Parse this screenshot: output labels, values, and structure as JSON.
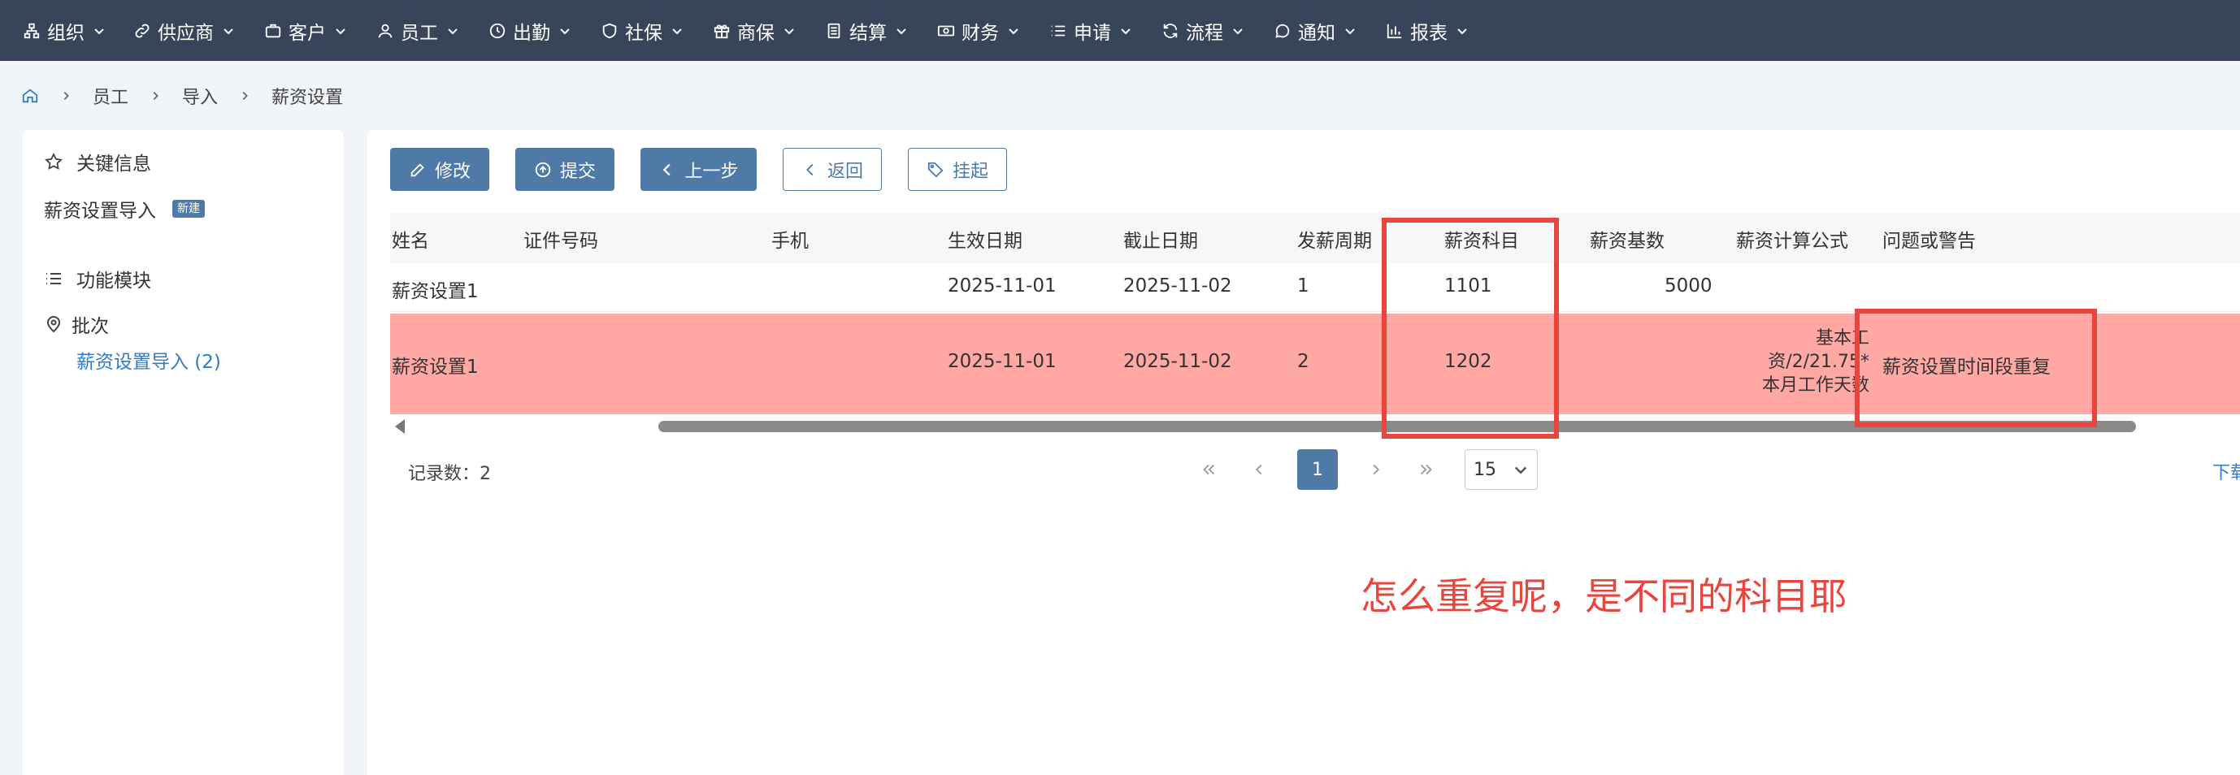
{
  "nav": {
    "items": [
      {
        "label": "组织",
        "icon": "org-icon"
      },
      {
        "label": "供应商",
        "icon": "link-icon"
      },
      {
        "label": "客户",
        "icon": "briefcase-icon"
      },
      {
        "label": "员工",
        "icon": "user-icon"
      },
      {
        "label": "出勤",
        "icon": "clock-icon"
      },
      {
        "label": "社保",
        "icon": "shield-icon"
      },
      {
        "label": "商保",
        "icon": "gift-icon"
      },
      {
        "label": "结算",
        "icon": "document-icon"
      },
      {
        "label": "财务",
        "icon": "money-icon"
      },
      {
        "label": "申请",
        "icon": "list-icon"
      },
      {
        "label": "流程",
        "icon": "refresh-icon"
      },
      {
        "label": "通知",
        "icon": "chat-icon"
      },
      {
        "label": "报表",
        "icon": "bar-chart-icon"
      }
    ]
  },
  "breadcrumb": {
    "items": [
      "员工",
      "导入",
      "薪资设置"
    ]
  },
  "sidebar": {
    "key_info": "关键信息",
    "import_item": "薪资设置导入",
    "new_badge": "新建",
    "modules": "功能模块",
    "batch": "批次",
    "batch_link": "薪资设置导入 (2)"
  },
  "toolbar": {
    "edit": "修改",
    "submit": "提交",
    "prev": "上一步",
    "back": "返回",
    "hang": "挂起"
  },
  "table": {
    "headers": [
      "姓名",
      "证件号码",
      "手机",
      "生效日期",
      "截止日期",
      "发薪周期",
      "薪资科目",
      "薪资基数",
      "薪资计算公式",
      "问题或警告"
    ],
    "rows": [
      {
        "name": "薪资设置1",
        "id_no": "",
        "phone": "",
        "start": "2025-11-01",
        "end": "2025-11-02",
        "cycle": "1",
        "subject": "1101",
        "base": "5000",
        "formula": [
          "",
          "",
          ""
        ],
        "warning": ""
      },
      {
        "name": "薪资设置1",
        "id_no": "",
        "phone": "",
        "start": "2025-11-01",
        "end": "2025-11-02",
        "cycle": "2",
        "subject": "1202",
        "base": "",
        "formula": [
          "基本工",
          "资/2/21.75*",
          "本月工作天数"
        ],
        "warning": "薪资设置时间段重复"
      }
    ]
  },
  "pagination": {
    "records_label": "记录数：2",
    "current_page": "1",
    "page_size": "15",
    "download": "下载"
  },
  "annotation": {
    "comment": "怎么重复呢，是不同的科目耶",
    "color": "#e8453c"
  },
  "colors": {
    "nav_bg": "#374459",
    "primary": "#4f7aa8",
    "error_row": "#ffa8a4",
    "link": "#2f7dc8"
  }
}
